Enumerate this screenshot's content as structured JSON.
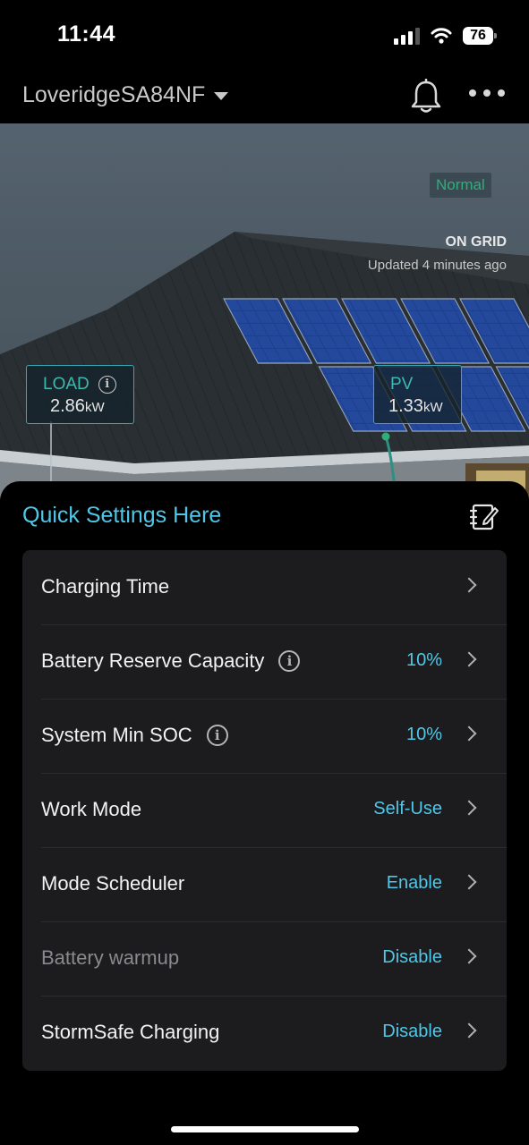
{
  "status_bar": {
    "time": "11:44",
    "battery": "76"
  },
  "header": {
    "site_name": "LoveridgeSA84NF"
  },
  "hero": {
    "status_badge": "Normal",
    "grid_status": "ON GRID",
    "updated": "Updated 4 minutes ago",
    "load": {
      "label": "LOAD",
      "value": "2.86",
      "unit": "kW"
    },
    "pv": {
      "label": "PV",
      "value": "1.33",
      "unit": "kW"
    }
  },
  "quick_settings": {
    "title": "Quick Settings Here",
    "items": [
      {
        "label": "Charging Time",
        "value": "",
        "info": false,
        "muted": false
      },
      {
        "label": "Battery Reserve Capacity",
        "value": "10%",
        "info": true,
        "muted": false
      },
      {
        "label": "System Min SOC",
        "value": "10%",
        "info": true,
        "muted": false
      },
      {
        "label": "Work Mode",
        "value": "Self-Use",
        "info": false,
        "muted": false
      },
      {
        "label": "Mode Scheduler",
        "value": "Enable",
        "info": false,
        "muted": false
      },
      {
        "label": "Battery warmup",
        "value": "Disable",
        "info": false,
        "muted": true
      },
      {
        "label": "StormSafe Charging",
        "value": "Disable",
        "info": false,
        "muted": false
      }
    ]
  },
  "colors": {
    "accent": "#4fc7e8",
    "ok": "#2fae7b",
    "card": "#1c1c1e"
  },
  "icons": [
    "bell-icon",
    "more-icon",
    "edit-icon",
    "info-icon",
    "chevron-right-icon",
    "caret-down-icon"
  ]
}
